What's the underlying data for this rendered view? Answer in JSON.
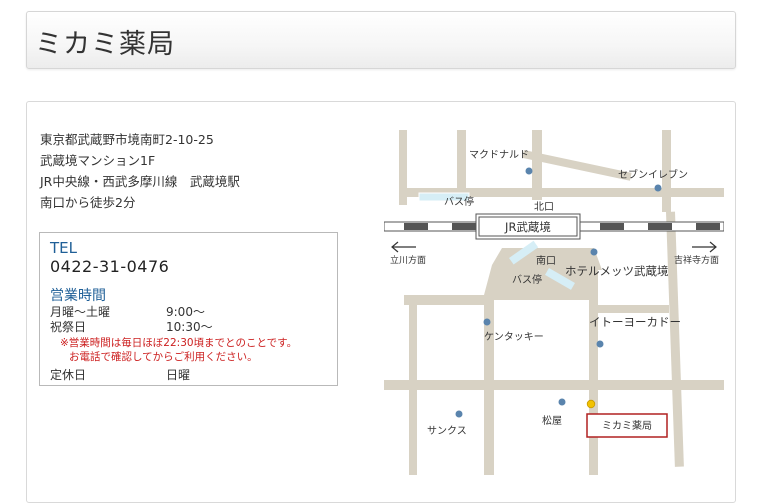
{
  "header": {
    "title": "ミカミ薬局"
  },
  "address": {
    "lines": [
      "東京都武蔵野市境南町2-10-25",
      "武蔵境マンション1F",
      "JR中央線・西武多摩川線　武蔵境駅",
      "南口から徒歩2分"
    ]
  },
  "info": {
    "tel_label": "TEL",
    "tel": "0422-31-0476",
    "hours_title": "営業時間",
    "rows": [
      {
        "day": "月曜～土曜",
        "time": "9:00～"
      },
      {
        "day": "祝祭日",
        "time": "10:30～"
      }
    ],
    "note_lines": [
      "※営業時間は毎日ほぼ22:30頃までとのことです。",
      "お電話で確認してからご利用ください。"
    ],
    "closed_label": "定休日",
    "closed_value": "日曜"
  },
  "map": {
    "station": "JR武蔵境",
    "north_exit": "北口",
    "south_exit": "南口",
    "left_direction": "立川方面",
    "right_direction": "吉祥寺方面",
    "bus_stop_north": "バス停",
    "bus_stop_south": "バス停",
    "places": {
      "mcdonalds": "マクドナルド",
      "seven_eleven": "セブンイレブン",
      "hotel_mets": "ホテルメッツ武蔵境",
      "kfc": "ケンタッキー",
      "itoyokado": "イトーヨーカドー",
      "sunkus": "サンクス",
      "matsuya": "松屋",
      "mikami": "ミカミ薬局"
    },
    "colors": {
      "road": "#d8d2c4",
      "road_border": "#ffffff",
      "dot": "#5a84ad",
      "target_dot": "#f2c200",
      "target_border": "#b02020",
      "rail_dark": "#555555"
    }
  }
}
